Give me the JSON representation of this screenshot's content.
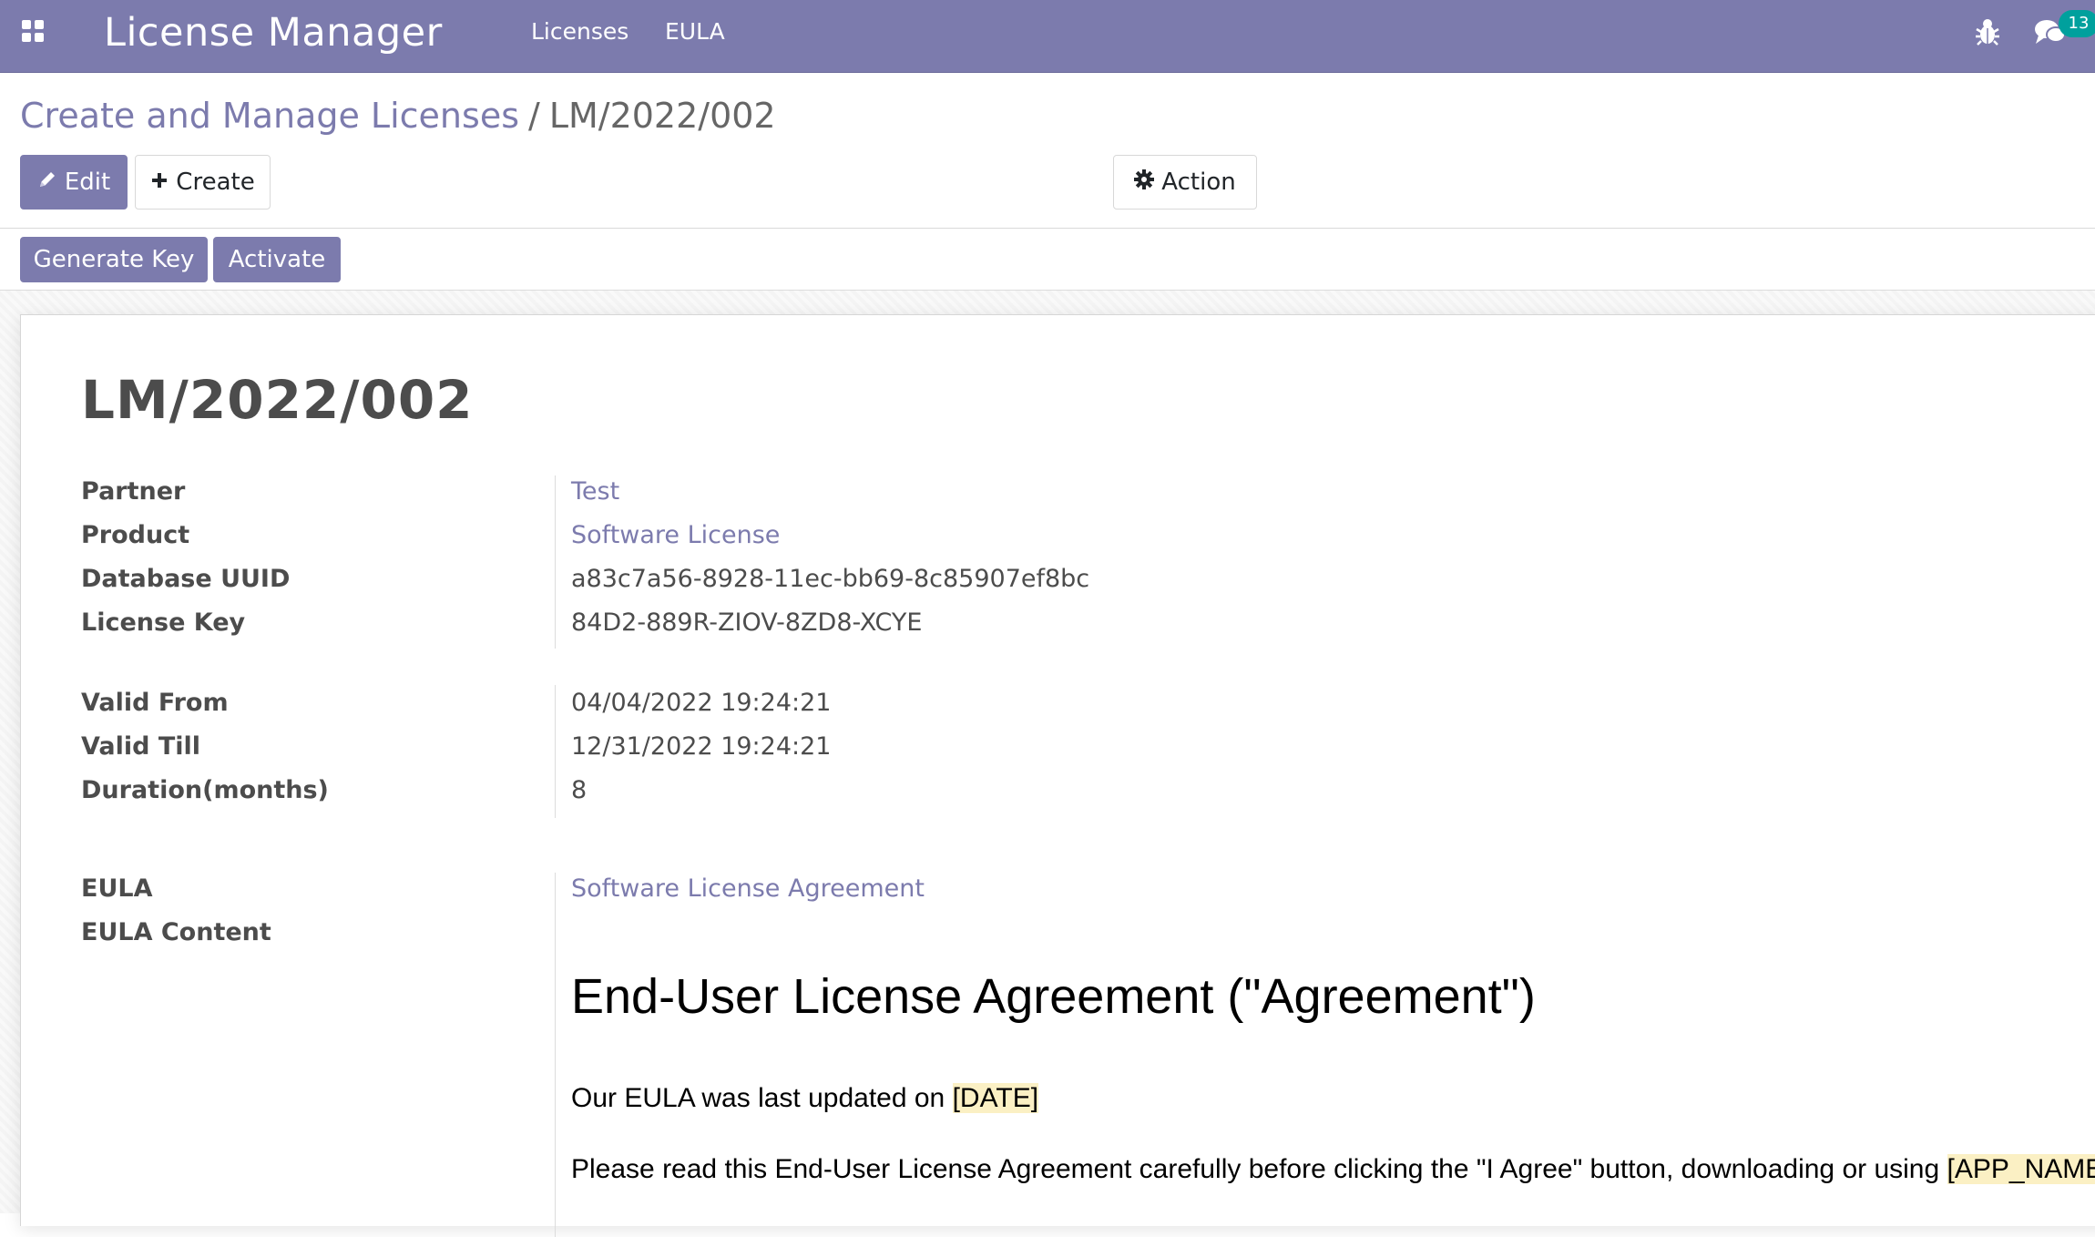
{
  "navbar": {
    "app_name": "License Manager",
    "menu": [
      "Licenses",
      "EULA"
    ],
    "icons": [
      "apps-grid-icon",
      "bug-icon",
      "chat-icon"
    ],
    "chat_count": "13",
    "color": "#7c7bad"
  },
  "breadcrumb": {
    "parent": "Create and Manage Licenses",
    "separator": "/",
    "current": "LM/2022/002"
  },
  "toolbar": {
    "edit_label": "Edit",
    "create_label": "Create",
    "action_label": "Action"
  },
  "statusbar": {
    "generate_key_label": "Generate Key",
    "activate_label": "Activate"
  },
  "record": {
    "title": "LM/2022/002",
    "group1": [
      {
        "label": "Partner",
        "value": "Test",
        "is_link": true
      },
      {
        "label": "Product",
        "value": "Software License",
        "is_link": true
      },
      {
        "label": "Database UUID",
        "value": "a83c7a56-8928-11ec-bb69-8c85907ef8bc",
        "is_link": false
      },
      {
        "label": "License Key",
        "value": "84D2-889R-ZIOV-8ZD8-XCYE",
        "is_link": false
      }
    ],
    "group2": [
      {
        "label": "Valid From",
        "value": "04/04/2022 19:24:21"
      },
      {
        "label": "Valid Till",
        "value": "12/31/2022 19:24:21"
      },
      {
        "label": "Duration(months)",
        "value": "8"
      }
    ],
    "eula_label": "EULA",
    "eula_value": "Software License Agreement",
    "eula_content_label": "EULA Content",
    "eula_content": {
      "heading": "End-User License Agreement (\"Agreement\")",
      "p1_text": "Our EULA was last updated on ",
      "p1_placeholder": "[DATE]",
      "p2_text": "Please read this End-User License Agreement carefully before clicking the \"I Agree\" button, downloading or using ",
      "p2_placeholder": "[APP_NAME]",
      "p2_end": "."
    }
  }
}
